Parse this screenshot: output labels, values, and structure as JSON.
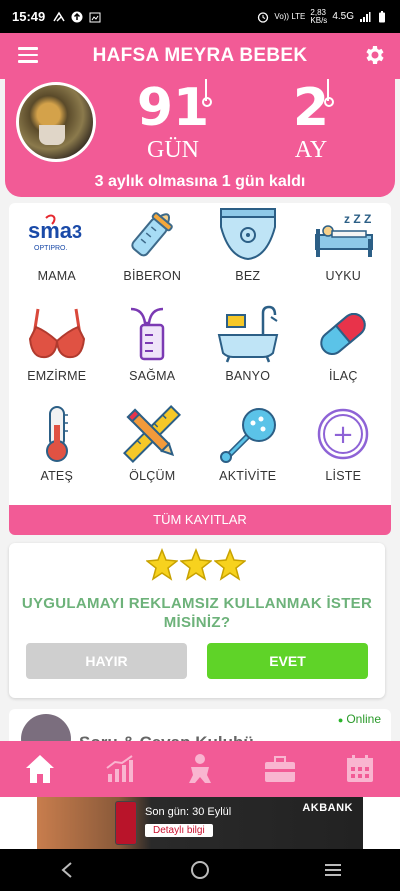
{
  "status_bar": {
    "time": "15:49",
    "network": "4.5G",
    "speed_value": "2,83",
    "speed_unit": "KB/s",
    "volte": "Vo)) LTE"
  },
  "app_bar": {
    "title": "HAFSA MEYRA BEBEK",
    "menu_icon": "hamburger-icon",
    "settings_icon": "gear-icon"
  },
  "header": {
    "days_value": "91",
    "days_unit": "GÜN",
    "months_value": "2",
    "months_unit": "AY",
    "remaining_text": "3 aylık olmasına 1 gün kaldı"
  },
  "grid": {
    "items": [
      {
        "label": "MAMA",
        "icon": "sma-formula-icon",
        "icon_text": "sma",
        "icon_num": "3",
        "icon_sub": "OPTIPRO."
      },
      {
        "label": "BİBERON",
        "icon": "baby-bottle-icon"
      },
      {
        "label": "BEZ",
        "icon": "diaper-icon"
      },
      {
        "label": "UYKU",
        "icon": "sleep-bed-icon",
        "icon_text": "z Z Z"
      },
      {
        "label": "EMZİRME",
        "icon": "bra-icon"
      },
      {
        "label": "SAĞMA",
        "icon": "breast-pump-icon"
      },
      {
        "label": "BANYO",
        "icon": "bathtub-icon"
      },
      {
        "label": "İLAÇ",
        "icon": "pill-icon"
      },
      {
        "label": "ATEŞ",
        "icon": "thermometer-icon"
      },
      {
        "label": "ÖLÇÜM",
        "icon": "ruler-pencil-icon"
      },
      {
        "label": "AKTİVİTE",
        "icon": "rattle-icon"
      },
      {
        "label": "LİSTE",
        "icon": "plus-circle-icon",
        "icon_text": "+"
      }
    ],
    "all_records": "TÜM KAYITLAR"
  },
  "ad_free": {
    "question": "UYGULAMAYI REKLAMSIZ KULLANMAK İSTER MİSİNİZ?",
    "no": "HAYIR",
    "yes": "EVET"
  },
  "club": {
    "title": "Soru & Cevap Kulubü",
    "status": "Online"
  },
  "bottom_nav": [
    "home-icon",
    "growth-chart-icon",
    "baby-icon",
    "toolbox-icon",
    "calendar-icon"
  ],
  "ad": {
    "text": "Son gün: 30 Eylül",
    "button": "Detaylı bilgi",
    "brand": "AKBANK"
  },
  "colors": {
    "primary": "#f25b96",
    "accent_green": "#5fd328",
    "question_green": "#6db27a",
    "disabled_gray": "#cfcfcf"
  }
}
